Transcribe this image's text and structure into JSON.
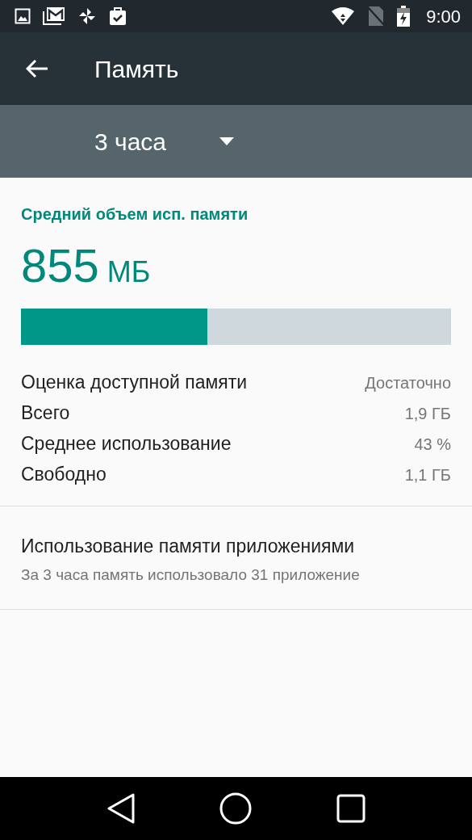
{
  "status_bar": {
    "time": "9:00"
  },
  "app_bar": {
    "title": "Память"
  },
  "period": {
    "value": "3 часа"
  },
  "summary": {
    "heading": "Средний объем исп. памяти",
    "amount": "855",
    "unit": "МБ",
    "level": 0.433
  },
  "stats": [
    {
      "label": "Оценка доступной памяти",
      "value": "Достаточно"
    },
    {
      "label": "Всего",
      "value": "1,9 ГБ"
    },
    {
      "label": "Среднее использование",
      "value": "43 %"
    },
    {
      "label": "Свободно",
      "value": "1,1 ГБ"
    }
  ],
  "apps_item": {
    "title": "Использование памяти приложениями",
    "subtitle": "За 3 часа память использовало 31 приложение"
  }
}
